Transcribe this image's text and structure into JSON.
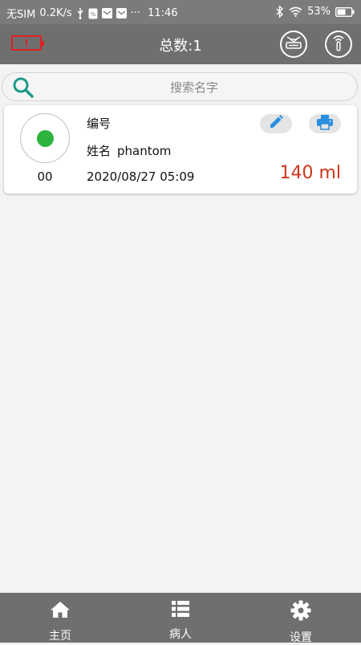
{
  "status_bar": {
    "carrier": "无SIM",
    "speed": "0.2K/s",
    "dots": "···",
    "time": "11:46",
    "battery": "53%"
  },
  "app_bar": {
    "title": "总数:1",
    "battery_warning": "!"
  },
  "search": {
    "placeholder": "搜索名字"
  },
  "patients": [
    {
      "id": "00",
      "number_label": "编号",
      "number_value": "",
      "name_label": "姓名",
      "name_value": "phantom",
      "datetime": "2020/08/27 05:09",
      "volume": "140 ml",
      "status_color": "#2db43e"
    }
  ],
  "bottom_nav": {
    "items": [
      {
        "label": "主页",
        "icon": "home-icon"
      },
      {
        "label": "病人",
        "icon": "list-icon"
      },
      {
        "label": "设置",
        "icon": "gear-icon"
      }
    ]
  },
  "colors": {
    "bar_bg": "#6f6f6f",
    "status_bg": "#7b7b7b",
    "accent_blue": "#2b8fe0",
    "volume_red": "#d0361c",
    "warning_red": "#e02020",
    "search_teal": "#1e9a8a"
  }
}
